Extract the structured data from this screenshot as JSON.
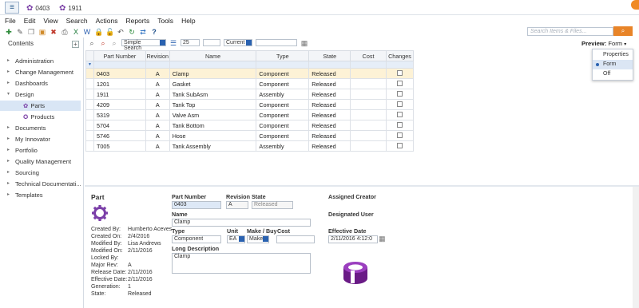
{
  "tabs": [
    {
      "label": "0403"
    },
    {
      "label": "1911"
    }
  ],
  "menu": [
    "File",
    "Edit",
    "View",
    "Search",
    "Actions",
    "Reports",
    "Tools",
    "Help"
  ],
  "search": {
    "placeholder": "Search Items & Files..."
  },
  "sidebar": {
    "title": "Contents",
    "items": [
      {
        "label": "Administration"
      },
      {
        "label": "Change Management"
      },
      {
        "label": "Dashboards"
      },
      {
        "label": "Design"
      },
      {
        "label": "Parts"
      },
      {
        "label": "Products"
      },
      {
        "label": "Documents"
      },
      {
        "label": "My Innovator"
      },
      {
        "label": "Portfolio"
      },
      {
        "label": "Quality Management"
      },
      {
        "label": "Sourcing"
      },
      {
        "label": "Technical Documentati..."
      },
      {
        "label": "Templates"
      }
    ]
  },
  "gridbar": {
    "search_mode": "Simple Search",
    "page_size": "25",
    "revision": "Current"
  },
  "preview": {
    "label": "Preview:",
    "value": "Form",
    "options": [
      "Properties",
      "Form",
      "Off"
    ]
  },
  "grid": {
    "columns": [
      "Part Number",
      "Revision",
      "Name",
      "Type",
      "State",
      "Cost",
      "Changes"
    ],
    "rows": [
      [
        "0403",
        "A",
        "Clamp",
        "Component",
        "Released"
      ],
      [
        "1201",
        "A",
        "Gasket",
        "Component",
        "Released"
      ],
      [
        "1911",
        "A",
        "Tank SubAsm",
        "Assembly",
        "Released"
      ],
      [
        "4209",
        "A",
        "Tank Top",
        "Component",
        "Released"
      ],
      [
        "5319",
        "A",
        "Valve Asm",
        "Component",
        "Released"
      ],
      [
        "5704",
        "A",
        "Tank Bottom",
        "Component",
        "Released"
      ],
      [
        "5746",
        "A",
        "Hose",
        "Component",
        "Released"
      ],
      [
        "T005",
        "A",
        "Tank Assembly",
        "Assembly",
        "Released"
      ]
    ]
  },
  "form": {
    "header": "Part",
    "labels": {
      "part_number": "Part Number",
      "revision": "Revision",
      "state": "State",
      "name": "Name",
      "type": "Type",
      "unit": "Unit",
      "make_buy": "Make / Buy",
      "cost": "Cost",
      "long_desc": "Long Description",
      "assigned_creator": "Assigned Creator",
      "designated_user": "Designated User",
      "effective_date": "Effective Date"
    },
    "values": {
      "part_number": "0403",
      "revision": "A",
      "state": "Released",
      "name": "Clamp",
      "type": "Component",
      "unit": "EA",
      "make_buy": "Make",
      "long_desc": "Clamp",
      "effective_date": "2/11/2016 4:12:0"
    },
    "meta": [
      {
        "k": "Created By:",
        "v": "Humberto Aceves"
      },
      {
        "k": "Created On:",
        "v": "2/4/2016"
      },
      {
        "k": "Modified By:",
        "v": "Lisa Andrews"
      },
      {
        "k": "Modified On:",
        "v": "2/11/2016"
      },
      {
        "k": "Locked By:",
        "v": ""
      },
      {
        "k": "Major Rev:",
        "v": "A"
      },
      {
        "k": "Release Date:",
        "v": "2/11/2016"
      },
      {
        "k": "Effective Date:",
        "v": "2/11/2016"
      },
      {
        "k": "Generation:",
        "v": "1"
      },
      {
        "k": "State:",
        "v": "Released"
      }
    ]
  }
}
